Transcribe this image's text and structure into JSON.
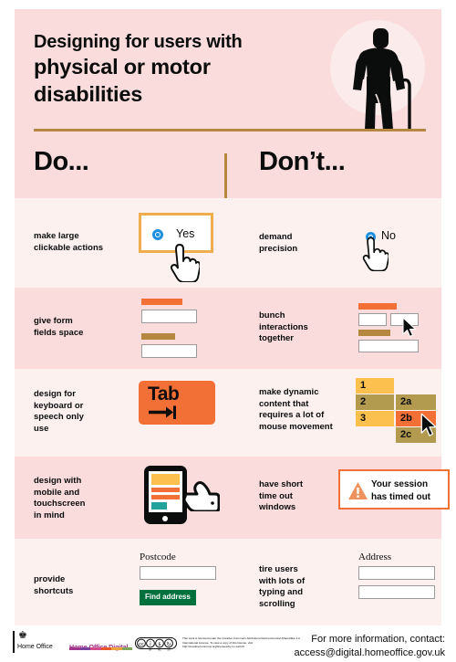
{
  "header": {
    "title_line1": "Designing for users with",
    "title_line2": "physical or motor",
    "title_line3": "disabilities",
    "figure_icon": "person-with-walking-cane-icon",
    "accent_rule_color": "#b5873f",
    "background_color": "#fadcdc"
  },
  "columns": {
    "do_label": "Do...",
    "dont_label": "Don’t..."
  },
  "rows": [
    {
      "do": {
        "label": "make large\nclickable actions",
        "label_line1": "make large",
        "label_line2": "clickable actions",
        "art": {
          "type": "large-radio-button",
          "option_label": "Yes",
          "radio_color": "#1d8fe0",
          "focus_border_color": "#f0ad4e",
          "cursor": "pointing-hand-cursor"
        }
      },
      "dont": {
        "label_line1": "demand",
        "label_line2": "precision",
        "art": {
          "type": "small-radio-button",
          "option_label": "No",
          "radio_color": "#1d8fe0",
          "cursor": "pointing-hand-cursor"
        }
      }
    },
    {
      "do": {
        "label_line1": "give form",
        "label_line2": "fields space",
        "art": {
          "type": "spaced-form-fields",
          "bar_colors": [
            "#f26f35",
            "#b5873f"
          ],
          "field_count": 2
        }
      },
      "dont": {
        "label_line1": "bunch",
        "label_line2": "interactions",
        "label_line3": "together",
        "art": {
          "type": "crowded-form-fields",
          "bar_colors": [
            "#f26f35",
            "#b5873f"
          ],
          "field_count": 3,
          "cursor": "arrow-cursor"
        }
      }
    },
    {
      "do": {
        "label_line1": "design for",
        "label_line2": "keyboard or",
        "label_line3": "speech only",
        "label_line4": "use",
        "art": {
          "type": "tab-key",
          "key_label": "Tab",
          "key_color": "#f26f35",
          "arrow_icon": "tab-arrow-icon"
        }
      },
      "dont": {
        "label_line1": "make dynamic",
        "label_line2": "content that",
        "label_line3": "requires a lot of",
        "label_line4": "mouse movement",
        "art": {
          "type": "nested-menu-blocks",
          "primary_blocks": [
            "1",
            "2",
            "3"
          ],
          "secondary_blocks": [
            "2a",
            "2b",
            "2c"
          ],
          "colors": {
            "yellow": "#fcc04f",
            "gold": "#b29a4e",
            "orange": "#f26f35"
          },
          "cursor": "arrow-cursor"
        }
      }
    },
    {
      "do": {
        "label_line1": "design with",
        "label_line2": "mobile and",
        "label_line3": "touchscreen",
        "label_line4": "in mind",
        "art": {
          "type": "tablet-with-pointing-hand",
          "screen_bar_colors": [
            "#fcc04f",
            "#f26f35",
            "#f26f35",
            "#21a39b"
          ],
          "icon": "tablet-icon"
        }
      },
      "dont": {
        "label_line1": "have short",
        "label_line2": "time out",
        "label_line3": "windows",
        "art": {
          "type": "timeout-warning",
          "warning_line1": "Your session",
          "warning_line2": "has timed out",
          "icon": "warning-triangle-icon",
          "border_color": "#f26f35",
          "icon_color": "#f0925e"
        }
      }
    },
    {
      "do": {
        "label_line1": "provide",
        "label_line2": "shortcuts",
        "art": {
          "type": "postcode-lookup",
          "field_label": "Postcode",
          "field_value": "",
          "button_label": "Find address",
          "button_color": "#00703c"
        }
      },
      "dont": {
        "label_line1": "tire users",
        "label_line2": "with lots of",
        "label_line3": "typing and",
        "label_line4": "scrolling",
        "art": {
          "type": "address-fields",
          "field_label": "Address",
          "field_count": 2
        }
      }
    }
  ],
  "footer": {
    "home_office_logo_text": "Home Office",
    "home_office_digital_logo_text": "Home Office Digital",
    "hod_swatch_colors": [
      "#a1348c",
      "#7b3f9d",
      "#d44a8c",
      "#e8562a",
      "#f0a33a",
      "#7fa65a"
    ],
    "cc_badge_icon": "creative-commons-badge-icon",
    "license_text": "This work is licensed under the Creative Commons Attribution-NonCommercial-ShareAlike 4.0 International License. To view a copy of this license, visit http://creativecommons.org/licenses/by-nc-sa/4.0/.",
    "contact_line1": "For more information, contact:",
    "contact_line2": "access@digital.homeoffice.gov.uk"
  }
}
